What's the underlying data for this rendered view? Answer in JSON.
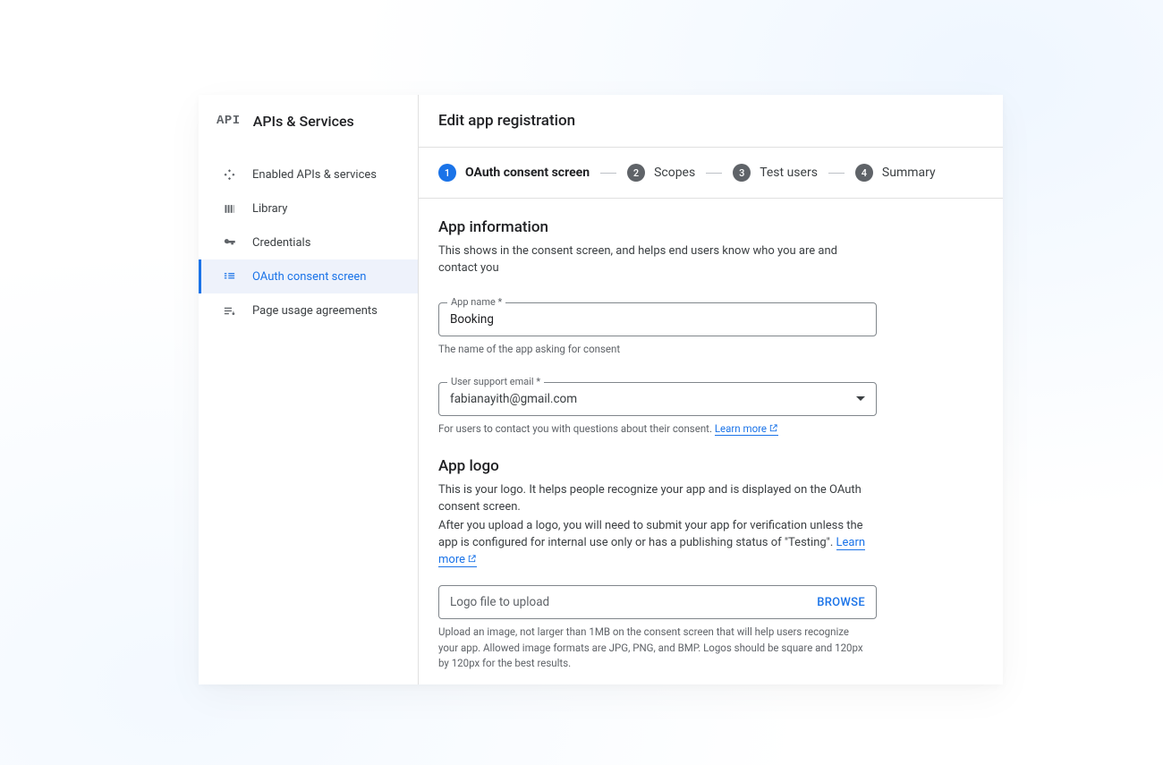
{
  "sidebar": {
    "logo_text": "API",
    "title": "APIs & Services",
    "items": [
      {
        "label": "Enabled APIs & services"
      },
      {
        "label": "Library"
      },
      {
        "label": "Credentials"
      },
      {
        "label": "OAuth consent screen"
      },
      {
        "label": "Page usage agreements"
      }
    ],
    "active_index": 3
  },
  "main": {
    "page_title": "Edit app registration",
    "stepper": [
      {
        "num": "1",
        "label": "OAuth consent screen"
      },
      {
        "num": "2",
        "label": "Scopes"
      },
      {
        "num": "3",
        "label": "Test users"
      },
      {
        "num": "4",
        "label": "Summary"
      }
    ],
    "active_step": 0
  },
  "app_info": {
    "title": "App information",
    "desc": "This shows in the consent screen, and helps end users know who you are and contact you",
    "app_name_label": "App name *",
    "app_name_value": "Booking",
    "app_name_helper": "The name of the app asking for consent",
    "support_email_label": "User support email *",
    "support_email_value": "fabianayith@gmail.com",
    "support_email_helper": "For users to contact you with questions about their consent. ",
    "learn_more": "Learn more"
  },
  "app_logo": {
    "title": "App logo",
    "desc1": "This is your logo. It helps people recognize your app and is displayed on the OAuth consent screen.",
    "desc2a": "After you upload a logo, you will need to submit your app for verification unless the app is configured for internal use only or has a publishing status of \"Testing\". ",
    "learn_more": "Learn more",
    "upload_placeholder": "Logo file to upload",
    "browse_label": "BROWSE",
    "upload_helper": "Upload an image, not larger than 1MB on the consent screen that will help users recognize your app. Allowed image formats are JPG, PNG, and BMP. Logos should be square and 120px by 120px for the best results."
  }
}
